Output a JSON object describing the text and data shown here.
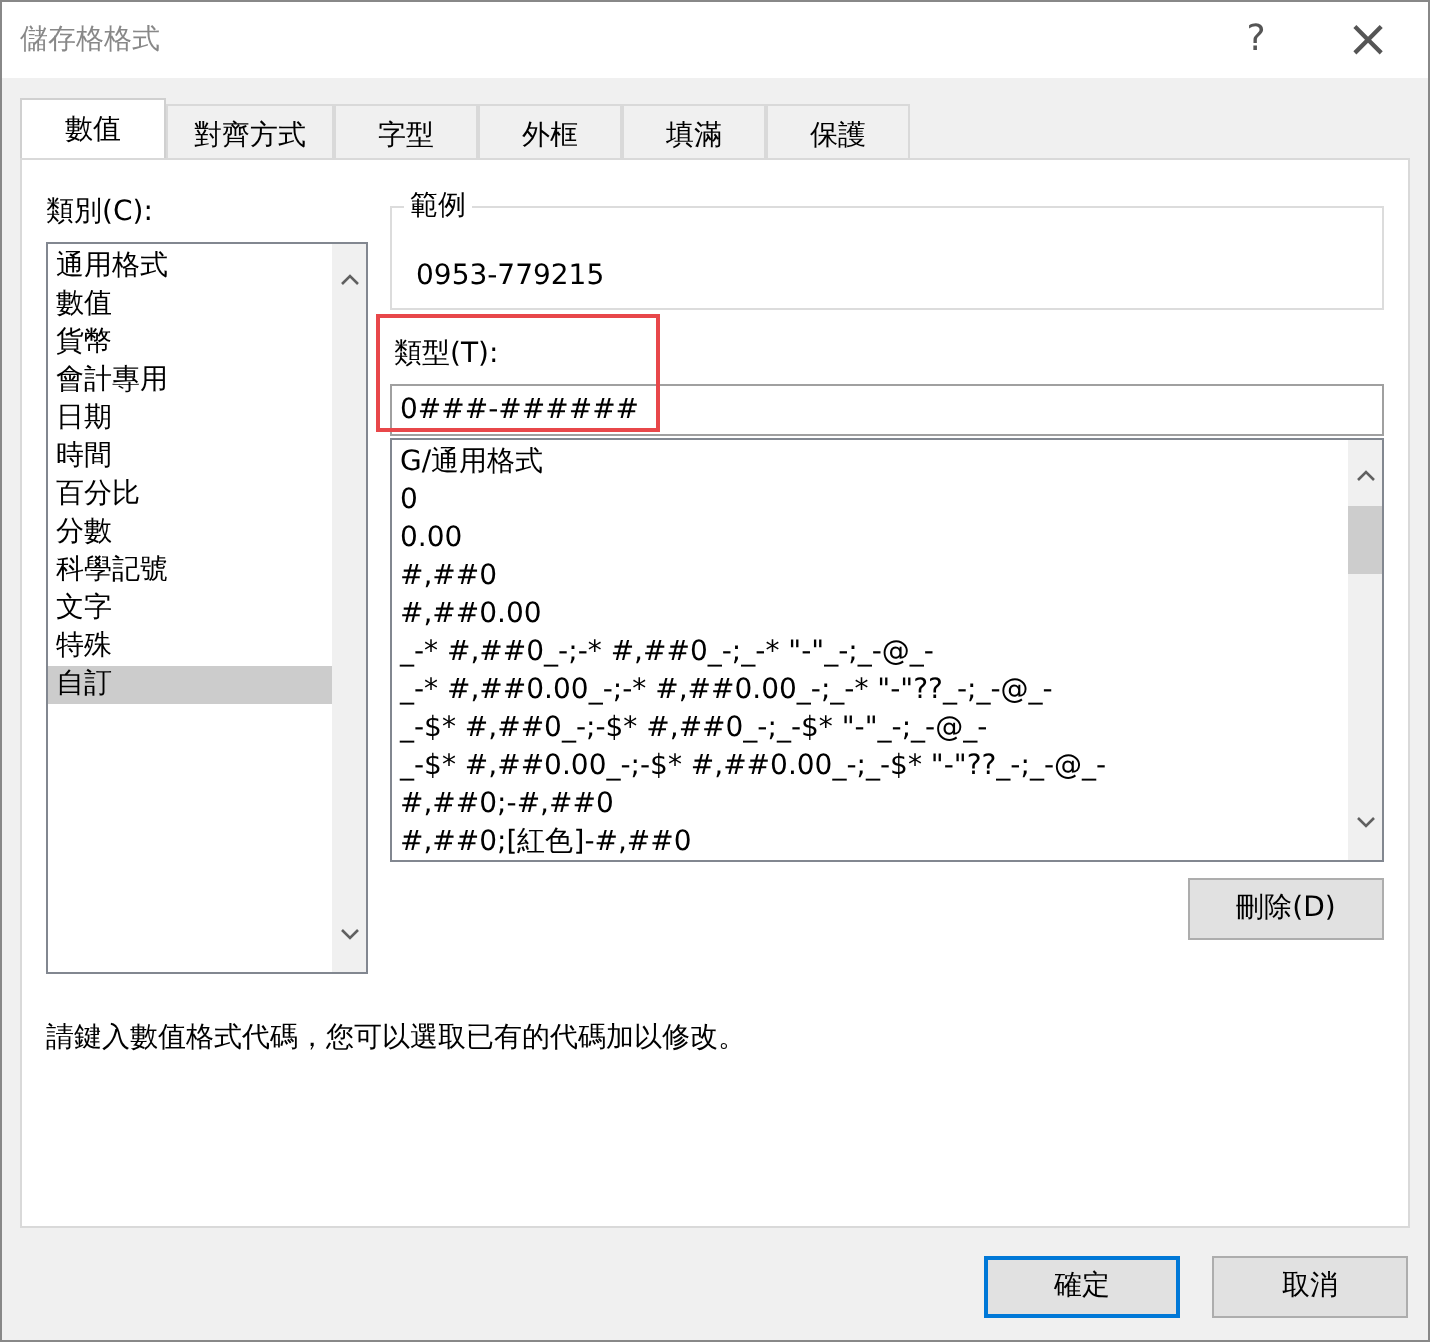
{
  "window": {
    "title": "儲存格格式",
    "help": "?",
    "close": "×"
  },
  "tabs": [
    {
      "label": "數值",
      "selected": true
    },
    {
      "label": "對齊方式",
      "selected": false
    },
    {
      "label": "字型",
      "selected": false
    },
    {
      "label": "外框",
      "selected": false
    },
    {
      "label": "填滿",
      "selected": false
    },
    {
      "label": "保護",
      "selected": false
    }
  ],
  "category": {
    "label": "類別(C):",
    "items": [
      {
        "label": "通用格式",
        "selected": false
      },
      {
        "label": "數值",
        "selected": false
      },
      {
        "label": "貨幣",
        "selected": false
      },
      {
        "label": "會計專用",
        "selected": false
      },
      {
        "label": "日期",
        "selected": false
      },
      {
        "label": "時間",
        "selected": false
      },
      {
        "label": "百分比",
        "selected": false
      },
      {
        "label": "分數",
        "selected": false
      },
      {
        "label": "科學記號",
        "selected": false
      },
      {
        "label": "文字",
        "selected": false
      },
      {
        "label": "特殊",
        "selected": false
      },
      {
        "label": "自訂",
        "selected": true
      }
    ]
  },
  "sample": {
    "label": "範例",
    "value": "0953-779215"
  },
  "type_field": {
    "label": "類型(T):",
    "value": "0###-######",
    "highlighted": true
  },
  "formats": [
    "G/通用格式",
    "0",
    "0.00",
    "#,##0",
    "#,##0.00",
    "_-* #,##0_-;-* #,##0_-;_-* \"-\"_-;_-@_-",
    "_-* #,##0.00_-;-* #,##0.00_-;_-* \"-\"??_-;_-@_-",
    "_-$* #,##0_-;-$* #,##0_-;_-$* \"-\"_-;_-@_-",
    "_-$* #,##0.00_-;-$* #,##0.00_-;_-$* \"-\"??_-;_-@_-",
    "#,##0;-#,##0",
    "#,##0;[紅色]-#,##0"
  ],
  "delete_button": "刪除(D)",
  "hint": "請鍵入數值格式代碼，您可以選取已有的代碼加以修改。",
  "buttons": [
    {
      "label": "確定",
      "default": true
    },
    {
      "label": "取消",
      "default": false
    }
  ]
}
